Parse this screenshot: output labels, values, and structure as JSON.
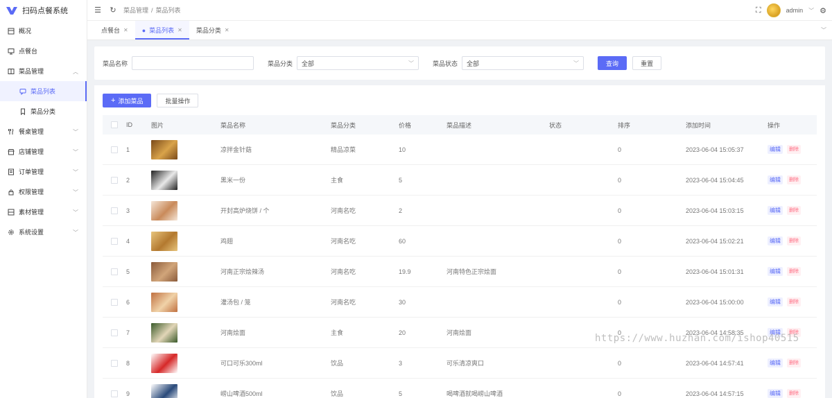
{
  "app": {
    "title": "扫码点餐系统"
  },
  "sidebar": {
    "items": [
      {
        "label": "概况",
        "icon": "dashboard-icon",
        "expandable": false
      },
      {
        "label": "点餐台",
        "icon": "monitor-icon",
        "expandable": false
      },
      {
        "label": "菜品管理",
        "icon": "book-icon",
        "expandable": true,
        "expanded": true,
        "children": [
          {
            "label": "菜品列表",
            "icon": "chat-icon",
            "active": true
          },
          {
            "label": "菜品分类",
            "icon": "bookmark-icon",
            "active": false
          }
        ]
      },
      {
        "label": "餐桌管理",
        "icon": "fork-knife-icon",
        "expandable": true
      },
      {
        "label": "店铺管理",
        "icon": "store-icon",
        "expandable": true
      },
      {
        "label": "订单管理",
        "icon": "order-icon",
        "expandable": true
      },
      {
        "label": "权限管理",
        "icon": "lock-icon",
        "expandable": true
      },
      {
        "label": "素材管理",
        "icon": "media-icon",
        "expandable": true
      },
      {
        "label": "系统设置",
        "icon": "gear-icon",
        "expandable": true
      }
    ]
  },
  "header": {
    "breadcrumb": [
      "菜品管理",
      "菜品列表"
    ],
    "breadcrumb_sep": "/",
    "user_name": "admin"
  },
  "tabs": [
    {
      "label": "点餐台",
      "active": false
    },
    {
      "label": "菜品列表",
      "active": true
    },
    {
      "label": "菜品分类",
      "active": false
    }
  ],
  "search": {
    "name_label": "菜品名称",
    "name_value": "",
    "category_label": "菜品分类",
    "category_value": "全部",
    "status_label": "菜品状态",
    "status_value": "全部",
    "query_label": "查询",
    "reset_label": "重置"
  },
  "toolbar": {
    "add_label": "添加菜品",
    "add_icon": "+",
    "batch_label": "批量操作"
  },
  "table": {
    "columns": [
      "ID",
      "图片",
      "菜品名称",
      "菜品分类",
      "价格",
      "菜品描述",
      "状态",
      "排序",
      "添加时间",
      "操作"
    ],
    "edit_label": "编辑",
    "delete_label": "删除",
    "rows": [
      {
        "id": "1",
        "name": "凉拌金针菇",
        "category": "精品凉菜",
        "price": "10",
        "desc": "",
        "status_on": true,
        "sort": "0",
        "time": "2023-06-04 15:05:37",
        "thumb": [
          "#7a4a1a",
          "#d9a34a"
        ]
      },
      {
        "id": "2",
        "name": "黑米一份",
        "category": "主食",
        "price": "5",
        "desc": "",
        "status_on": true,
        "sort": "0",
        "time": "2023-06-04 15:04:45",
        "thumb": [
          "#222222",
          "#e9e9e9"
        ]
      },
      {
        "id": "3",
        "name": "开封高炉烧饼 / 个",
        "category": "河南名吃",
        "price": "2",
        "desc": "",
        "status_on": true,
        "sort": "0",
        "time": "2023-06-04 15:03:15",
        "thumb": [
          "#f5e6d8",
          "#c98a5a"
        ]
      },
      {
        "id": "4",
        "name": "鸡翅",
        "category": "河南名吃",
        "price": "60",
        "desc": "",
        "status_on": true,
        "sort": "0",
        "time": "2023-06-04 15:02:21",
        "thumb": [
          "#e7c47c",
          "#b3792f"
        ]
      },
      {
        "id": "5",
        "name": "河南正宗烩辣汤",
        "category": "河南名吃",
        "price": "19.9",
        "desc": "河南特色正宗烩面",
        "status_on": true,
        "sort": "0",
        "time": "2023-06-04 15:01:31",
        "thumb": [
          "#8a5a3a",
          "#d1a57a"
        ]
      },
      {
        "id": "6",
        "name": "灌汤包 / 笼",
        "category": "河南名吃",
        "price": "30",
        "desc": "",
        "status_on": true,
        "sort": "0",
        "time": "2023-06-04 15:00:00",
        "thumb": [
          "#c07040",
          "#f0d2a8"
        ]
      },
      {
        "id": "7",
        "name": "河南烩面",
        "category": "主食",
        "price": "20",
        "desc": "河南烩面",
        "status_on": true,
        "sort": "0",
        "time": "2023-06-04 14:58:35",
        "thumb": [
          "#3a5a2a",
          "#e2d6b8"
        ]
      },
      {
        "id": "8",
        "name": "可口可乐300ml",
        "category": "饮品",
        "price": "3",
        "desc": "可乐清凉爽口",
        "status_on": true,
        "sort": "0",
        "time": "2023-06-04 14:57:41",
        "thumb": [
          "#ffffff",
          "#d62828"
        ]
      },
      {
        "id": "9",
        "name": "崂山啤酒500ml",
        "category": "饮品",
        "price": "5",
        "desc": "喝啤酒就喝崂山啤酒",
        "status_on": true,
        "sort": "0",
        "time": "2023-06-04 14:57:15",
        "thumb": [
          "#ffffff",
          "#2a4a7a"
        ]
      }
    ]
  },
  "watermark": "https://www.huzhan.com/ishop40515",
  "colors": {
    "primary": "#5b6bf6",
    "danger": "#ff6b81"
  }
}
